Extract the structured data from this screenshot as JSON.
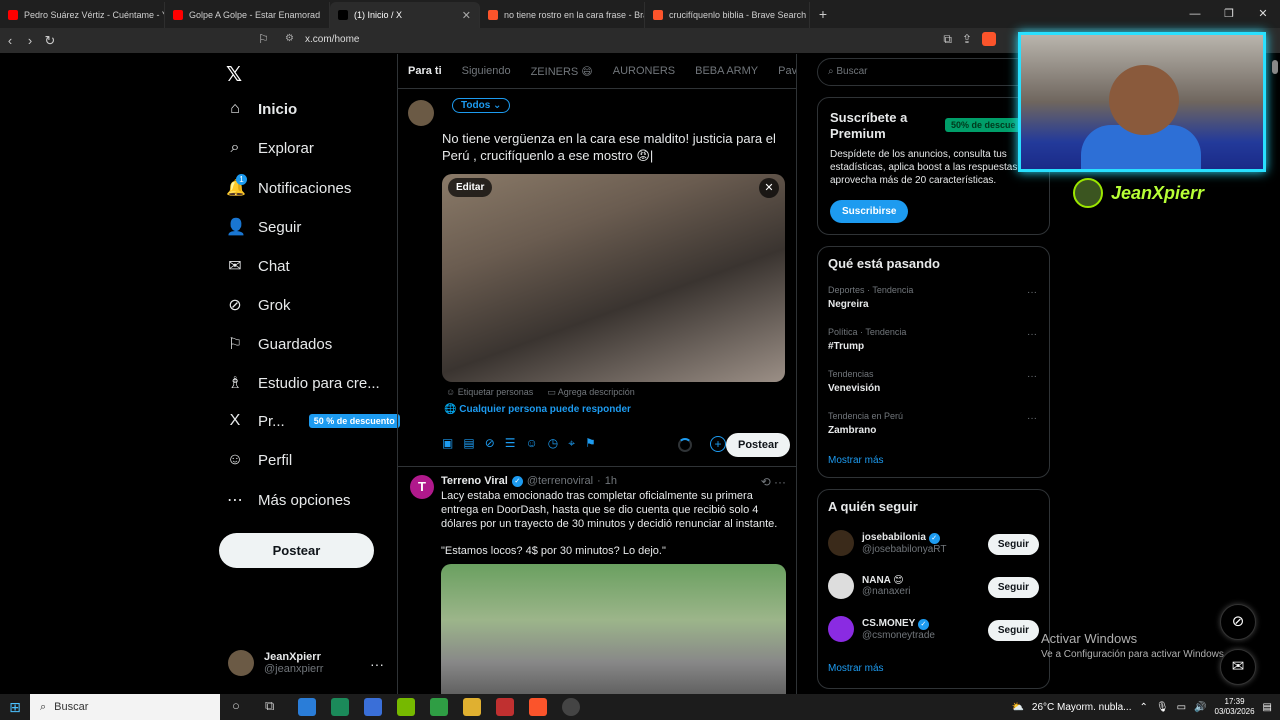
{
  "browser": {
    "tabs": [
      {
        "title": "Pedro Suárez Vértiz - Cuéntame - Yo",
        "color": "#ff0000",
        "active": false
      },
      {
        "title": "Golpe A Golpe - Estar Enamorad",
        "color": "#ff0000",
        "active": false
      },
      {
        "title": "(1) Inicio / X",
        "color": "#000000",
        "active": true
      },
      {
        "title": "no tiene rostro en la cara frase - Bra",
        "color": "#fb542b",
        "active": false
      },
      {
        "title": "crucifíquenlo biblia - Brave Search",
        "color": "#fb542b",
        "active": false
      }
    ],
    "url": "x.com/home"
  },
  "nav": {
    "items": [
      {
        "label": "Inicio",
        "icon": "home-icon",
        "glyph": "⌂"
      },
      {
        "label": "Explorar",
        "icon": "search-icon",
        "glyph": "⌕"
      },
      {
        "label": "Notificaciones",
        "icon": "bell-icon",
        "glyph": "🔔"
      },
      {
        "label": "Seguir",
        "icon": "add-user-icon",
        "glyph": "👤"
      },
      {
        "label": "Chat",
        "icon": "mail-icon",
        "glyph": "✉"
      },
      {
        "label": "Grok",
        "icon": "grok-icon",
        "glyph": "⊘"
      },
      {
        "label": "Guardados",
        "icon": "bookmark-icon",
        "glyph": "⚐"
      },
      {
        "label": "Estudio para cre...",
        "icon": "studio-icon",
        "glyph": "♗"
      },
      {
        "label": "Pr...",
        "icon": "premium-icon",
        "glyph": "X"
      },
      {
        "label": "Perfil",
        "icon": "profile-icon",
        "glyph": "☺"
      },
      {
        "label": "Más opciones",
        "icon": "more-icon",
        "glyph": "⋯"
      }
    ],
    "premium_badge": "50 % de descuento",
    "notif_count": "1",
    "post_button": "Postear",
    "user_name": "JeanXpierr",
    "user_handle": "@jeanxpierr"
  },
  "feed": {
    "tabs": [
      "Para ti",
      "Siguiendo",
      "ZEINERS 😄",
      "AURONERS",
      "BEBA ARMY",
      "Pavo Ra"
    ],
    "composer": {
      "audience": "Todos ⌄",
      "text": "No tiene vergüenza en la cara  ese maldito!  justicia para el Perú , crucifíquenlo a ese mostro 😡|",
      "edit_label": "Editar",
      "tag_people": "Etiquetar personas",
      "add_description": "Agrega descripción",
      "reply_setting": "Cualquier persona puede responder",
      "post_button": "Postear"
    },
    "tweet": {
      "name": "Terreno Viral",
      "handle": "@terrenoviral",
      "time": "1h",
      "paragraphs": [
        "Lacy estaba emocionado tras completar oficialmente su primera entrega en DoorDash, hasta que se dio cuenta que recibió solo 4 dólares por un trayecto de 30 minutos y decidió renunciar al instante.",
        "\"Estamos locos? 4$ por 30 minutos? Lo dejo.\""
      ]
    }
  },
  "sidebar": {
    "search_placeholder": "Buscar",
    "premium": {
      "title": "Suscríbete a Premium",
      "badge": "50% de descue",
      "desc": "Despídete de los anuncios, consulta tus estadísticas, aplica boost a las respuestas y aprovecha más de 20 características.",
      "button": "Suscribirse"
    },
    "trends_title": "Qué está pasando",
    "trends": [
      {
        "category": "Deportes · Tendencia",
        "topic": "Negreira"
      },
      {
        "category": "Política · Tendencia",
        "topic": "#Trump"
      },
      {
        "category": "Tendencias",
        "topic": "Venevisión"
      },
      {
        "category": "Tendencia en Perú",
        "topic": "Zambrano"
      }
    ],
    "show_more": "Mostrar más",
    "follow_title": "A quién seguir",
    "follow": [
      {
        "name": "josebabilonia",
        "handle": "@josebabilonyaRT",
        "button": "Seguir",
        "verified": true
      },
      {
        "name": "NANA 😊",
        "handle": "@nanaxeri",
        "button": "Seguir",
        "verified": false
      },
      {
        "name": "CS.MONEY",
        "handle": "@csmoneytrade",
        "button": "Seguir",
        "verified": true
      }
    ],
    "show_more_2": "Mostrar más"
  },
  "overlay": {
    "streamer": "JeanXpierr",
    "activate_title": "Activar Windows",
    "activate_sub": "Ve a Configuración para activar Windows."
  },
  "taskbar": {
    "search": "Buscar",
    "weather": "26°C  Mayorm. nubla...",
    "time": "17:39",
    "date": "03/03/2026"
  }
}
